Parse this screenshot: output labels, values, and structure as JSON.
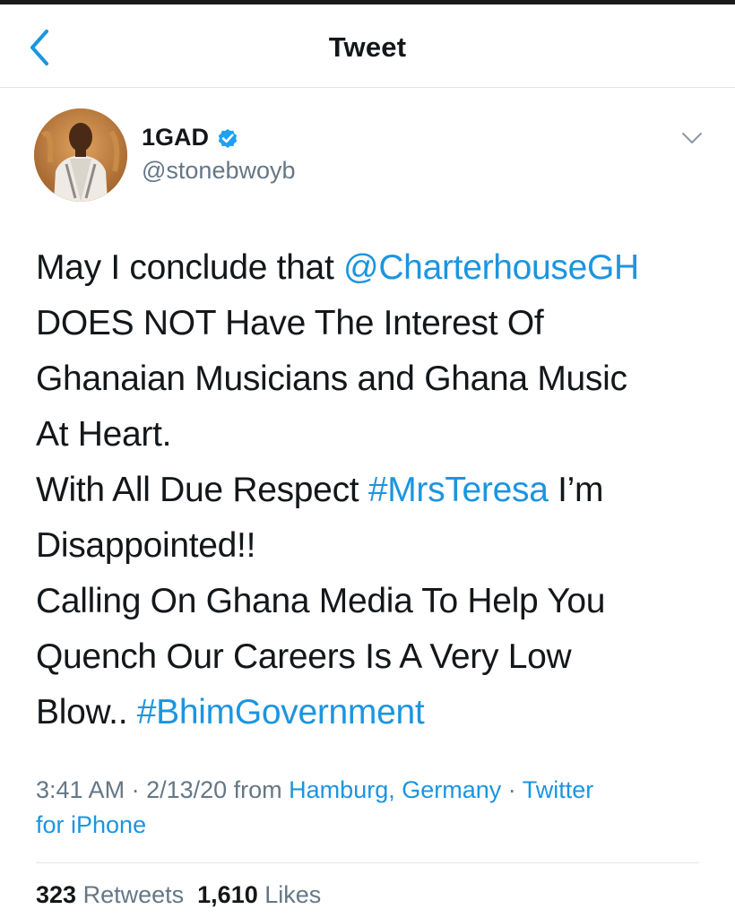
{
  "header": {
    "title": "Tweet",
    "back_icon": "chevron-left-icon"
  },
  "colors": {
    "accent": "#1b95e0",
    "secondary_text": "#657786",
    "primary_text": "#14171a"
  },
  "tweet": {
    "author": {
      "display_name": "1GAD",
      "handle": "@stonebwoyb",
      "verified_icon": "verified-badge-icon",
      "avatar_icon": "avatar-photo"
    },
    "menu_icon": "chevron-down-icon",
    "lines": [
      {
        "text": "May I conclude that ",
        "link": "@CharterhouseGH",
        "after": ""
      },
      {
        "text": "DOES NOT Have The Interest Of",
        "link": "",
        "after": ""
      },
      {
        "text": "Ghanaian Musicians and Ghana Music",
        "link": "",
        "after": ""
      },
      {
        "text": "At Heart.",
        "link": "",
        "after": ""
      },
      {
        "text": "With All Due Respect ",
        "link": "#MrsTeresa",
        "after": " I’m"
      },
      {
        "text": "Disappointed!!",
        "link": "",
        "after": ""
      },
      {
        "text": "Calling On Ghana Media To Help You",
        "link": "",
        "after": ""
      },
      {
        "text": "Quench Our Careers Is A Very Low",
        "link": "",
        "after": ""
      },
      {
        "text": "Blow.. ",
        "link": "#BhimGovernment",
        "after": ""
      }
    ],
    "meta": {
      "time": "3:41 AM",
      "separator": " · ",
      "date": "2/13/20",
      "from_label": " from ",
      "location": "Hamburg, Germany",
      "separator2": " · ",
      "source_line1": "Twitter",
      "source_line2": "for iPhone"
    },
    "stats": {
      "retweets_count": "323",
      "retweets_label": "Retweets",
      "likes_count": "1,610",
      "likes_label": "Likes"
    }
  }
}
